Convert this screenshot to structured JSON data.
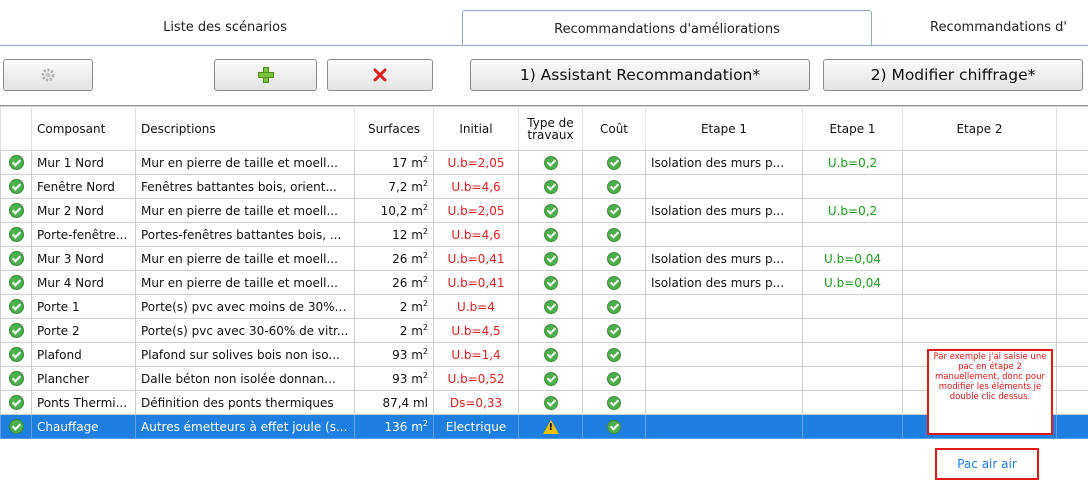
{
  "tabs": [
    {
      "label": "Liste des scénarios"
    },
    {
      "label": "Recommandations d'améliorations"
    },
    {
      "label": "Recommandations d'"
    }
  ],
  "toolbar": {
    "assistant_label": "1) Assistant Recommandation*",
    "modify_label": "2) Modifier chiffrage*"
  },
  "table": {
    "headers": [
      "Composant",
      "Descriptions",
      "Surfaces",
      "Initial",
      "Type de travaux",
      "Coût",
      "Etape 1",
      "Etape 1",
      "Etape 2"
    ],
    "rows": [
      {
        "composant": "Mur  1 Nord",
        "description": "Mur en pierre de taille et moell...",
        "surface": "17 m²",
        "initial": "U.b=2,05",
        "etape1": "Isolation des murs p...",
        "etape1b": "U.b=0,2",
        "etape2": ""
      },
      {
        "composant": "Fenêtre Nord",
        "description": "Fenêtres battantes bois, orient...",
        "surface": "7,2 m²",
        "initial": "U.b=4,6",
        "etape1": "",
        "etape1b": "",
        "etape2": ""
      },
      {
        "composant": "Mur  2 Nord",
        "description": "Mur en pierre de taille et moell...",
        "surface": "10,2 m²",
        "initial": "U.b=2,05",
        "etape1": "Isolation des murs p...",
        "etape1b": "U.b=0,2",
        "etape2": ""
      },
      {
        "composant": "Porte-fenêtre...",
        "description": "Portes-fenêtres battantes bois, ...",
        "surface": "12 m²",
        "initial": "U.b=4,6",
        "etape1": "",
        "etape1b": "",
        "etape2": ""
      },
      {
        "composant": "Mur  3 Nord",
        "description": "Mur en pierre de taille et moell...",
        "surface": "26 m²",
        "initial": "U.b=0,41",
        "etape1": "Isolation des murs p...",
        "etape1b": "U.b=0,04",
        "etape2": ""
      },
      {
        "composant": "Mur  4 Nord",
        "description": "Mur en pierre de taille et moell...",
        "surface": "26 m²",
        "initial": "U.b=0,41",
        "etape1": "Isolation des murs p...",
        "etape1b": "U.b=0,04",
        "etape2": ""
      },
      {
        "composant": "Porte  1",
        "description": "Porte(s) pvc avec moins de 30% ...",
        "surface": "2 m²",
        "initial": "U.b=4",
        "etape1": "",
        "etape1b": "",
        "etape2": ""
      },
      {
        "composant": "Porte  2",
        "description": "Porte(s) pvc avec 30-60% de vitr...",
        "surface": "2 m²",
        "initial": "U.b=4,5",
        "etape1": "",
        "etape1b": "",
        "etape2": ""
      },
      {
        "composant": "Plafond",
        "description": "Plafond sur solives bois non iso...",
        "surface": "93 m²",
        "initial": "U.b=1,4",
        "etape1": "",
        "etape1b": "",
        "etape2": ""
      },
      {
        "composant": "Plancher",
        "description": "Dalle béton non isolée donnan...",
        "surface": "93 m²",
        "initial": "U.b=0,52",
        "etape1": "",
        "etape1b": "",
        "etape2": ""
      },
      {
        "composant": "Ponts Thermi...",
        "description": "Définition des ponts thermiques",
        "surface": "87,4 ml",
        "initial": "Ds=0,33",
        "etape1": "",
        "etape1b": "",
        "etape2": ""
      },
      {
        "composant": "Chauffage",
        "description": "Autres émetteurs à effet joule (s...",
        "surface": "136 m²",
        "initial": "Electrique",
        "etape1": "",
        "etape1b": "",
        "etape2": "Pac air air"
      }
    ]
  },
  "annotation": {
    "text": "Par exemple j'ai saisie une pac en étape 2 manuellement, donc pour modifier les éléments je double clic dessus."
  },
  "colors": {
    "selected_row": "#1f7fe0",
    "accent_red": "#e01818",
    "ok_green": "#4cae4c"
  }
}
